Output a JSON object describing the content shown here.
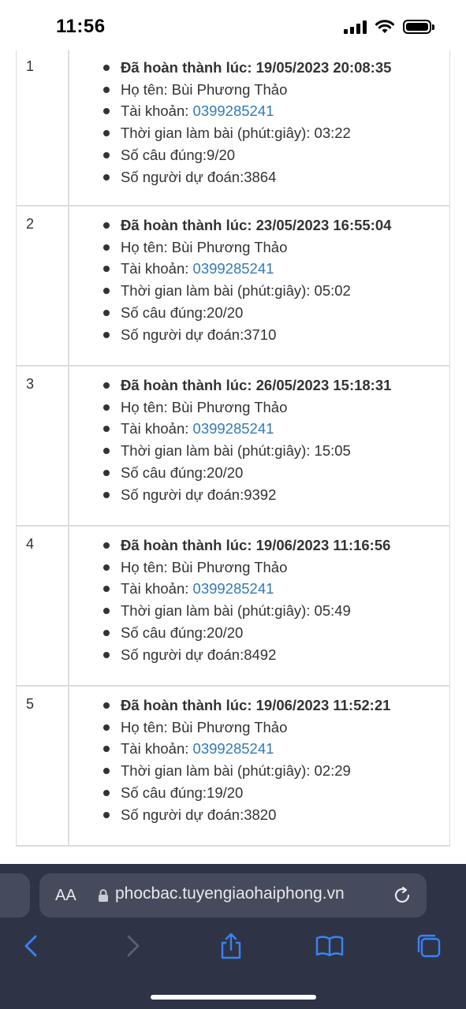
{
  "status_bar": {
    "time": "11:56"
  },
  "results": [
    {
      "index": "1",
      "completed": "Đã hoàn thành lúc: 19/05/2023 20:08:35",
      "name": "Họ tên: Bùi Phương Thảo",
      "account_label": "Tài khoản: ",
      "account": "0399285241",
      "duration": "Thời gian làm bài (phút:giây): 03:22",
      "correct": "Số câu đúng:9/20",
      "predictions": "Số người dự đoán:3864"
    },
    {
      "index": "2",
      "completed": "Đã hoàn thành lúc: 23/05/2023 16:55:04",
      "name": "Họ tên: Bùi Phương Thảo",
      "account_label": "Tài khoản: ",
      "account": "0399285241",
      "duration": "Thời gian làm bài (phút:giây): 05:02",
      "correct": "Số câu đúng:20/20",
      "predictions": "Số người dự đoán:3710"
    },
    {
      "index": "3",
      "completed": "Đã hoàn thành lúc: 26/05/2023 15:18:31",
      "name": "Họ tên: Bùi Phương Thảo",
      "account_label": "Tài khoản: ",
      "account": "0399285241",
      "duration": "Thời gian làm bài (phút:giây): 15:05",
      "correct": "Số câu đúng:20/20",
      "predictions": "Số người dự đoán:9392"
    },
    {
      "index": "4",
      "completed": "Đã hoàn thành lúc: 19/06/2023 11:16:56",
      "name": "Họ tên: Bùi Phương Thảo",
      "account_label": "Tài khoản: ",
      "account": "0399285241",
      "duration": "Thời gian làm bài (phút:giây): 05:49",
      "correct": "Số câu đúng:20/20",
      "predictions": "Số người dự đoán:8492"
    },
    {
      "index": "5",
      "completed": "Đã hoàn thành lúc: 19/06/2023 11:52:21",
      "name": "Họ tên: Bùi Phương Thảo",
      "account_label": "Tài khoản: ",
      "account": "0399285241",
      "duration": "Thời gian làm bài (phút:giây): 02:29",
      "correct": "Số câu đúng:19/20",
      "predictions": "Số người dự đoán:3820"
    }
  ],
  "browser": {
    "text_size_label": "AA",
    "url": "phocbac.tuyengiaohaiphong.vn",
    "icons": [
      "lock-icon",
      "reload-icon",
      "back-icon",
      "forward-icon",
      "share-icon",
      "bookmarks-icon",
      "tabs-icon"
    ]
  },
  "colors": {
    "link": "#337ab7",
    "browser_bg": "#2e3446",
    "icon_blue": "#3b82f6"
  }
}
